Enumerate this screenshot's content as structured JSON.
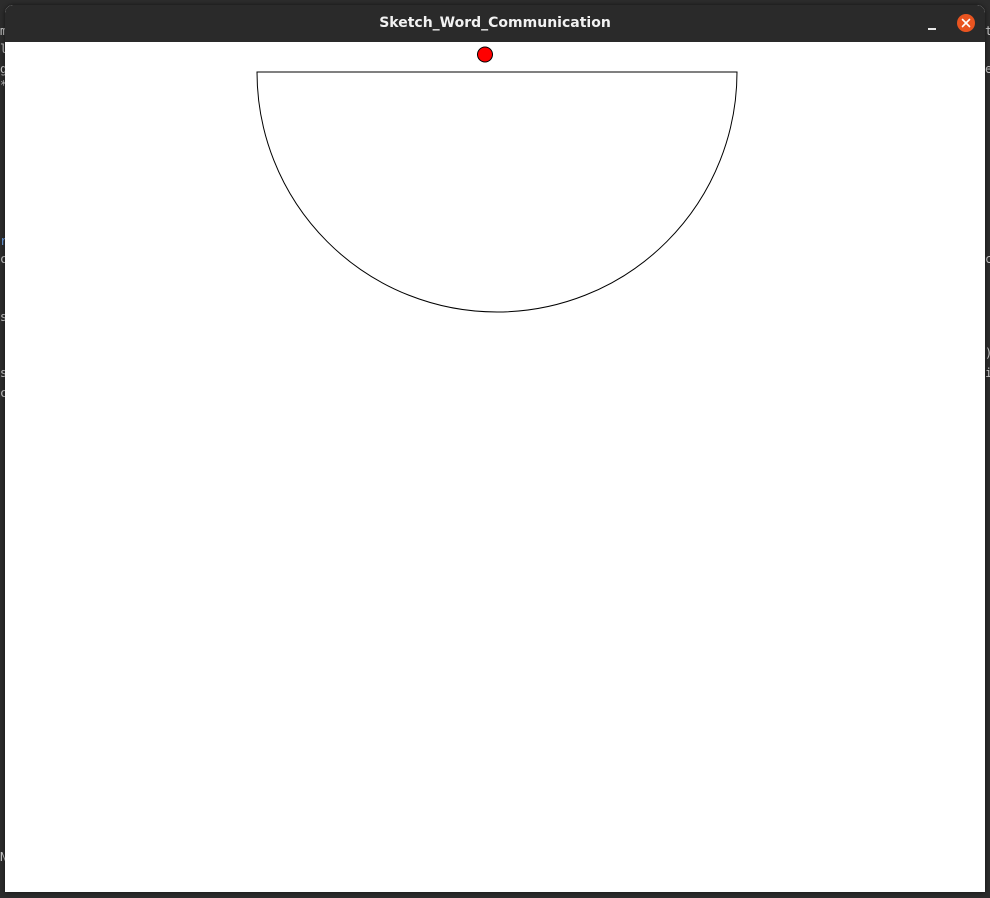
{
  "window": {
    "title": "Sketch_Word_Communication",
    "close_color": "#e95420"
  },
  "sketch": {
    "dot_color": "#ff0000",
    "shape": "half-disc"
  }
}
